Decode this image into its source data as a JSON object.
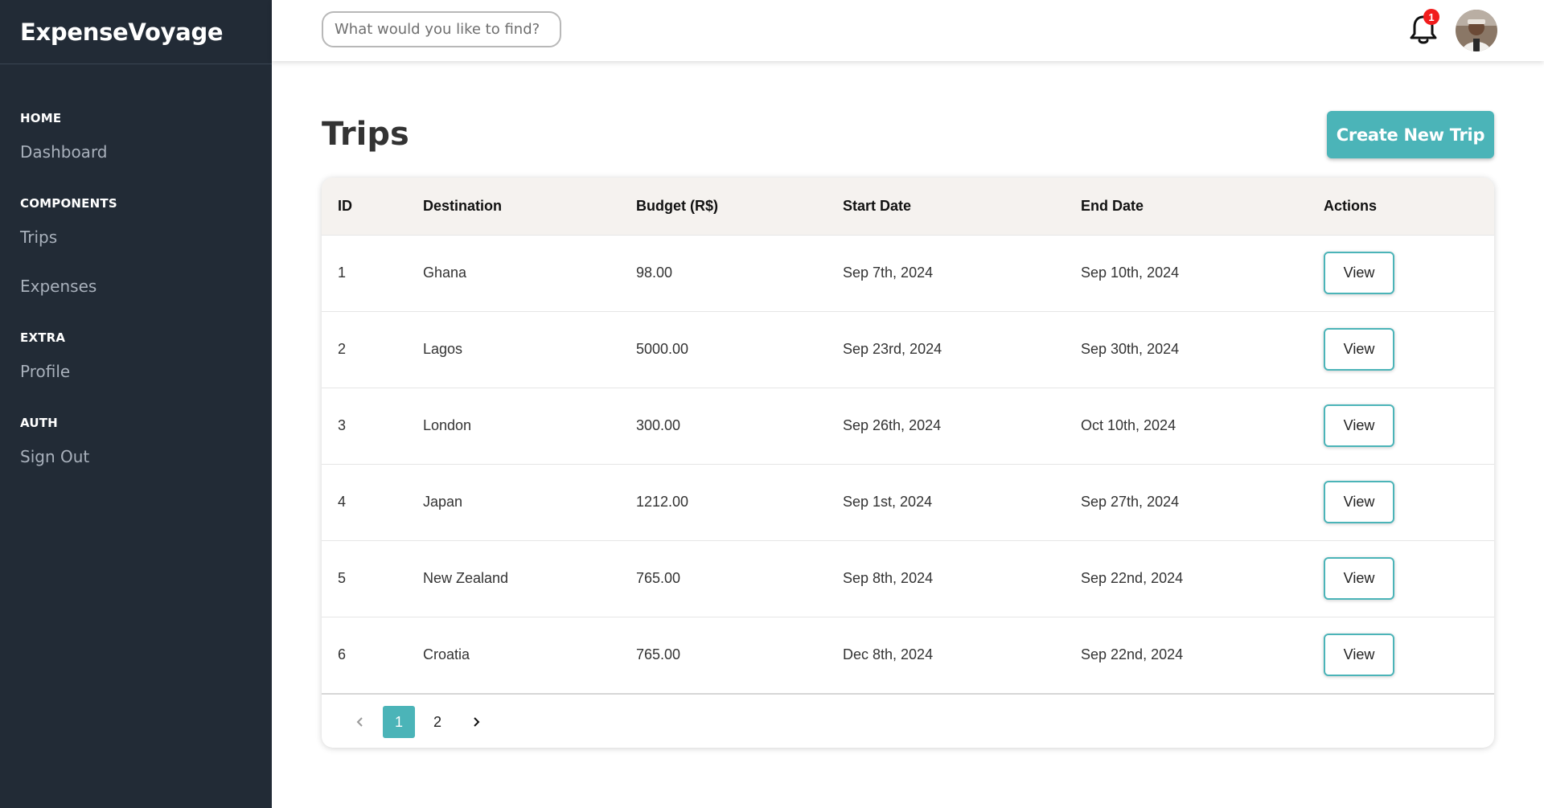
{
  "brand": "ExpenseVoyage",
  "sidebar": {
    "sections": [
      {
        "heading": "HOME",
        "items": [
          "Dashboard"
        ]
      },
      {
        "heading": "COMPONENTS",
        "items": [
          "Trips",
          "Expenses"
        ]
      },
      {
        "heading": "EXTRA",
        "items": [
          "Profile"
        ]
      },
      {
        "heading": "AUTH",
        "items": [
          "Sign Out"
        ]
      }
    ]
  },
  "header": {
    "search_placeholder": "What would you like to find?",
    "notification_count": "1"
  },
  "main": {
    "title": "Trips",
    "create_button": "Create New Trip",
    "table": {
      "columns": [
        "ID",
        "Destination",
        "Budget (R$)",
        "Start Date",
        "End Date",
        "Actions"
      ],
      "rows": [
        {
          "id": "1",
          "destination": "Ghana",
          "budget": "98.00",
          "start": "Sep 7th, 2024",
          "end": "Sep 10th, 2024",
          "action": "View"
        },
        {
          "id": "2",
          "destination": "Lagos",
          "budget": "5000.00",
          "start": "Sep 23rd, 2024",
          "end": "Sep 30th, 2024",
          "action": "View"
        },
        {
          "id": "3",
          "destination": "London",
          "budget": "300.00",
          "start": "Sep 26th, 2024",
          "end": "Oct 10th, 2024",
          "action": "View"
        },
        {
          "id": "4",
          "destination": "Japan",
          "budget": "1212.00",
          "start": "Sep 1st, 2024",
          "end": "Sep 27th, 2024",
          "action": "View"
        },
        {
          "id": "5",
          "destination": "New Zealand",
          "budget": "765.00",
          "start": "Sep 8th, 2024",
          "end": "Sep 22nd, 2024",
          "action": "View"
        },
        {
          "id": "6",
          "destination": "Croatia",
          "budget": "765.00",
          "start": "Dec 8th, 2024",
          "end": "Sep 22nd, 2024",
          "action": "View"
        }
      ]
    },
    "pagination": {
      "pages": [
        "1",
        "2"
      ],
      "current": "1"
    }
  },
  "icons": {
    "notification": "bell-icon",
    "prev": "chevron-left-icon",
    "next": "chevron-right-icon"
  },
  "colors": {
    "accent": "#4bb4b8",
    "sidebar_bg": "#222b36",
    "badge": "#f11c1c"
  }
}
